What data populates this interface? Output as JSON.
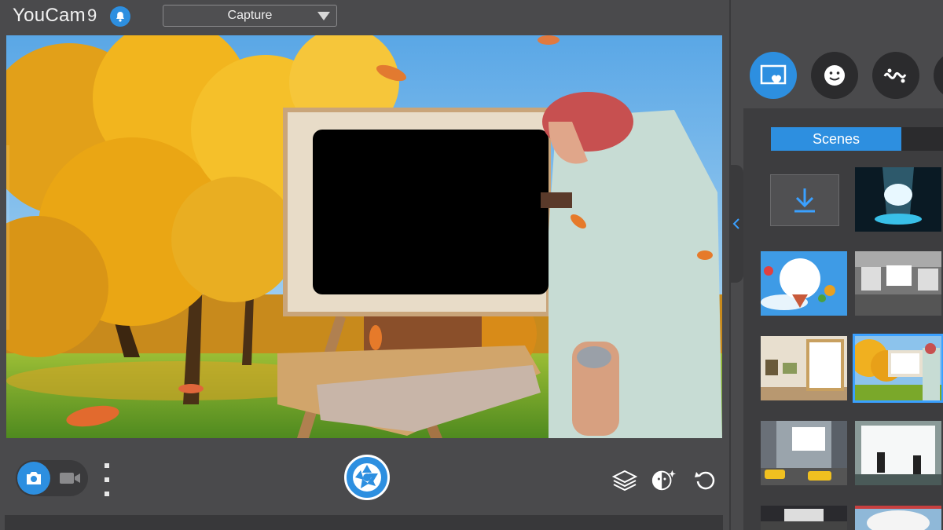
{
  "app": {
    "name": "YouCam",
    "version": "9"
  },
  "header": {
    "mode_select": {
      "selected": "Capture",
      "options": [
        "Capture"
      ]
    },
    "notification_icon": "bell-icon"
  },
  "bottom_bar": {
    "mode_toggle": {
      "active": "photo",
      "icons": [
        "camera-icon",
        "video-camera-icon"
      ]
    },
    "tools": [
      "layers-icon",
      "face-effects-icon",
      "reset-icon"
    ]
  },
  "right_panel": {
    "tabs": [
      {
        "id": "scenes",
        "icon": "scene-frame-icon",
        "active": true
      },
      {
        "id": "emoji",
        "icon": "smiley-icon",
        "active": false
      },
      {
        "id": "distortion",
        "icon": "squiggle-icon",
        "active": false
      },
      {
        "id": "more",
        "icon": "more-icon",
        "active": false
      }
    ],
    "segment": {
      "active_label": "Scenes"
    },
    "scenes": [
      {
        "name": "download-more",
        "icon": "download-icon"
      },
      {
        "name": "spotlight-stage"
      },
      {
        "name": "hot-air-balloons"
      },
      {
        "name": "city-billboards-bw"
      },
      {
        "name": "gallery-frames"
      },
      {
        "name": "autumn-painter",
        "selected": true
      },
      {
        "name": "taxi-street"
      },
      {
        "name": "window-cleaners"
      },
      {
        "name": "arena-screen"
      },
      {
        "name": "round-billboard"
      }
    ]
  },
  "colors": {
    "accent": "#2d8fe0",
    "background": "#4a4a4c",
    "panel": "#3d3d3f"
  }
}
